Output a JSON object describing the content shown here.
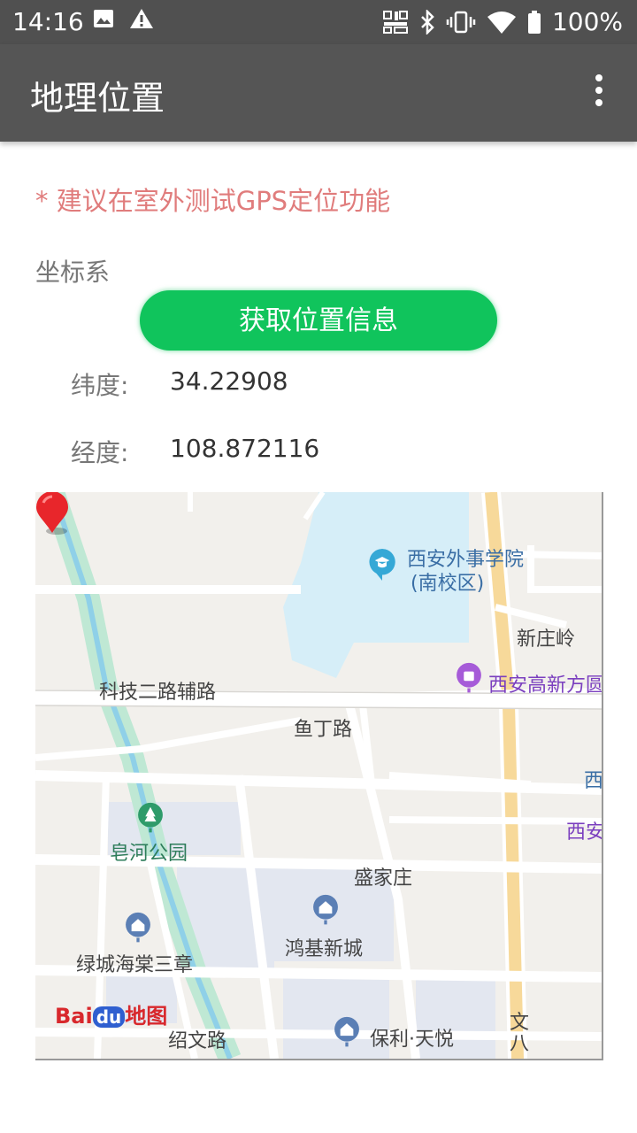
{
  "status_bar": {
    "time": "14:16",
    "battery": "100%"
  },
  "app_bar": {
    "title": "地理位置"
  },
  "hint": "* 建议在室外测试GPS定位功能",
  "coord_system_label": "坐标系",
  "get_location_button": "获取位置信息",
  "latitude": {
    "label": "纬度:",
    "value": "34.22908"
  },
  "longitude": {
    "label": "经度:",
    "value": "108.872116"
  },
  "map": {
    "labels": {
      "xisu": "西安外事学院",
      "xisu_sub": "(南校区)",
      "xinzhuangling": "新庄岭",
      "keji_road": "科技二路辅路",
      "gaoxin": "西安高新方圆",
      "yuding_road": "鱼丁路",
      "xi": "西",
      "xian": "西安",
      "zaohe_park": "皂河公园",
      "shengjiazhuang": "盛家庄",
      "hongji": "鸿基新城",
      "lvcheng": "绿城海棠三章",
      "baoli": "保利·天悦",
      "shaowen_road": "绍文路",
      "wenba": "文八"
    },
    "logo_text": "Bai",
    "logo_du": "du",
    "logo_map": "地图"
  }
}
